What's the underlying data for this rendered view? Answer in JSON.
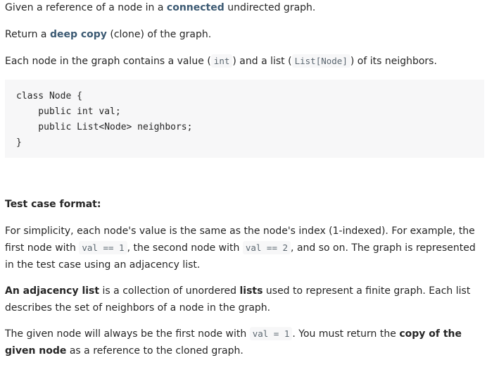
{
  "para1": {
    "text_a": "Given a reference of a node in a ",
    "bold": "connected",
    "text_b": " undirected graph."
  },
  "para2": {
    "text_a": "Return a ",
    "bold": "deep copy",
    "text_b": " (clone) of the graph."
  },
  "para3": {
    "text_a": "Each node in the graph contains a value (",
    "code1": "int",
    "text_b": ") and a list (",
    "code2": "List[Node]",
    "text_c": ") of its neighbors."
  },
  "code_block": {
    "lines": [
      "class Node {",
      "    public int val;",
      "    public List<Node> neighbors;",
      "}"
    ]
  },
  "test_case_heading": "Test case format:",
  "para5": {
    "text_a": "For simplicity, each node's value is the same as the node's index (1-indexed). For example, the first node with ",
    "code1": "val == 1",
    "text_b": ", the second node with ",
    "code2": "val == 2",
    "text_c": ", and so on. The graph is represented in the test case using an adjacency list."
  },
  "para6": {
    "bold1": "An adjacency list",
    "text_a": " is a collection of unordered ",
    "bold2": "lists",
    "text_b": " used to represent a finite graph. Each list describes the set of neighbors of a node in the graph."
  },
  "para7": {
    "text_a": "The given node will always be the first node with ",
    "code1": "val = 1",
    "text_b": ". You must return the ",
    "bold": "copy of the given node",
    "text_c": " as a reference to the cloned graph."
  }
}
